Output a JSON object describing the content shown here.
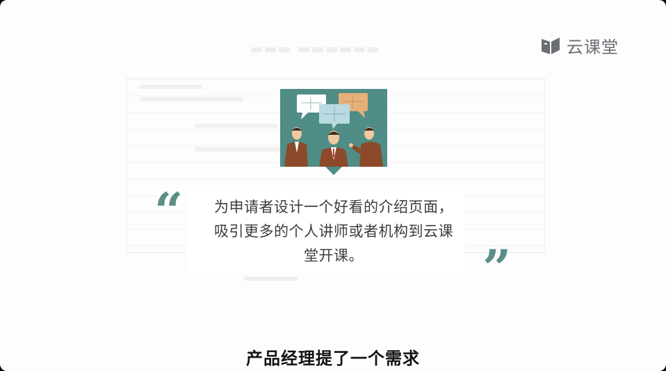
{
  "brand": {
    "name": "云课堂",
    "icon": "book-icon"
  },
  "quote": {
    "open_mark": "“",
    "text": "为申请者设计一个好看的介绍页面，吸引更多的个人讲师或者机构到云课堂开课。",
    "close_mark": "”",
    "accent_color": "#5a8f87"
  },
  "illustration": {
    "icon": "team-discussion-puzzle-illustration"
  },
  "subtitle": "产品经理提了一个需求"
}
